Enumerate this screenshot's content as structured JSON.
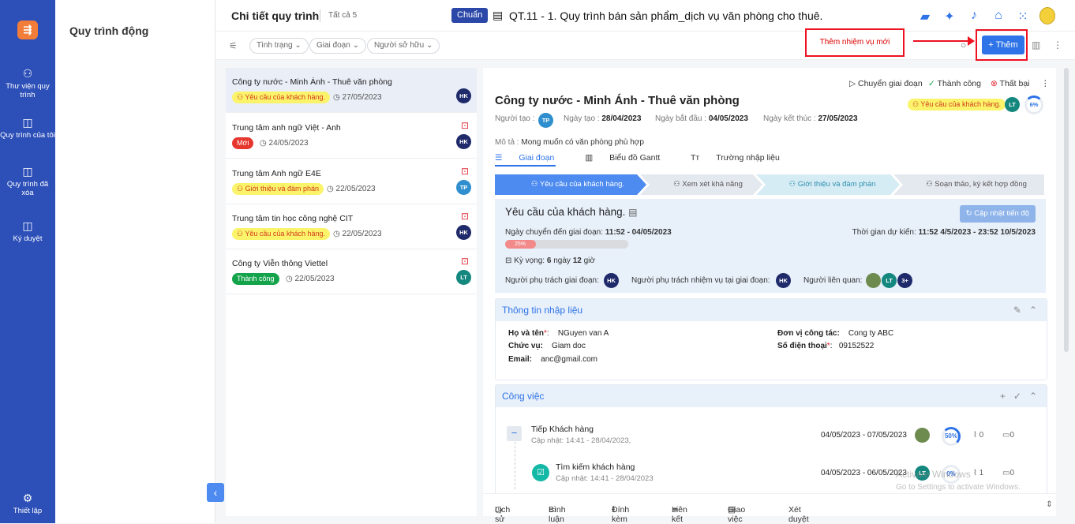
{
  "sidebar": {
    "logo": "⇶",
    "items": [
      {
        "label": "Thư viện quy trình",
        "icon": "process-library-icon"
      },
      {
        "label": "Quy trình của tôi",
        "icon": "my-process-icon"
      },
      {
        "label": "Quy trình đã xóa",
        "icon": "deleted-process-icon"
      },
      {
        "label": "Ký duyệt",
        "icon": "approval-icon"
      }
    ],
    "settings_label": "Thiết lập"
  },
  "subnav": {
    "title": "Quy trình động"
  },
  "header": {
    "page_title": "Chi tiết quy trình",
    "count": "Tất cả 5",
    "badge": "Chuẩn",
    "process_title": "QT.11 - 1. Quy trình bán sản phẩm_dịch vụ văn phòng cho thuê."
  },
  "filters": {
    "status": "Tình trạng",
    "stage": "Giai đoạn",
    "owner": "Người sở hữu"
  },
  "callout": "Thêm nhiệm vụ mới",
  "add_button": "+ Thêm",
  "list": [
    {
      "name": "Công ty nước - Minh Ánh - Thuê văn phòng",
      "tag": "Yêu cầu của khách hàng.",
      "date": "27/05/2023",
      "avatar": "HK"
    },
    {
      "name": "Trung tâm anh ngữ Việt - Anh",
      "tag": "Mới",
      "date": "24/05/2023",
      "avatar": "HK"
    },
    {
      "name": "Trung tâm Anh ngữ E4E",
      "tag": "Giới thiệu và đàm phán",
      "date": "22/05/2023",
      "avatar": "TP"
    },
    {
      "name": "Trung tâm tin học công nghệ CIT",
      "tag": "Yêu cầu của khách hàng.",
      "date": "22/05/2023",
      "avatar": "HK"
    },
    {
      "name": "Công ty Viễn thông Viettel",
      "tag": "Thành công",
      "date": "22/05/2023",
      "avatar": "LT"
    }
  ],
  "detail": {
    "actions": {
      "move": "Chuyển giai đoạn",
      "success": "Thành công",
      "fail": "Thất bại"
    },
    "title": "Công ty nước - Minh Ánh - Thuê văn phòng",
    "tag": "Yêu cầu của khách hàng.",
    "owner_avatar": "LT",
    "percent": "6%",
    "creator_label": "Người tạo :",
    "creator_avatar": "TP",
    "created_label": "Ngày tạo :",
    "created": "28/04/2023",
    "start_label": "Ngày bắt đầu :",
    "start": "04/05/2023",
    "end_label": "Ngày kết thúc :",
    "end": "27/05/2023",
    "desc_label": "Mô tả :",
    "desc": "Mong muốn có văn phòng phù hợp",
    "tabs": [
      "Giai đoạn",
      "Biểu đồ Gantt",
      "Trường nhập liệu"
    ],
    "stages": [
      "Yêu cầu của khách hàng.",
      "Xem xét khả năng",
      "Giới thiệu và đàm phán",
      "Soạn thảo, ký kết hợp đồng"
    ],
    "stage_box": {
      "title": "Yêu cầu của khách hàng.",
      "update_button": "Cập nhật tiến độ",
      "moved_label": "Ngày chuyển đến giai đoạn:",
      "moved": "11:52 - 04/05/2023",
      "expected_label": "Thời gian dự kiến:",
      "expected": "11:52 4/5/2023 - 23:52 10/5/2023",
      "progress_text": "25%",
      "progress": 0.25,
      "expect_label": "Kỳ vọng:",
      "expect_days": "6",
      "expect_days_unit": "ngày",
      "expect_hours": "12",
      "expect_hours_unit": "giờ",
      "stage_owner_label": "Người phụ trách giai đoạn:",
      "stage_owner": "HK",
      "task_owner_label": "Người phụ trách nhiệm vụ tại giai đoạn:",
      "task_owner": "HK",
      "related_label": "Người liên quan:",
      "related": [
        "LT",
        "3+"
      ]
    },
    "input_info": {
      "title": "Thông tin nhập liệu",
      "name_label": "Họ và tên",
      "name": "NGuyen van A",
      "unit_label": "Đơn vị công tác:",
      "unit": "Cong ty ABC",
      "position_label": "Chức vụ:",
      "position": "Giam doc",
      "phone_label": "Số điện thoại",
      "phone": "09152522",
      "email_label": "Email:",
      "email": "anc@gmail.com"
    },
    "work": {
      "title": "Công việc",
      "tasks": [
        {
          "name": "Tiếp Khách hàng",
          "updated": "Cập nhật: 14:41 - 28/04/2023,",
          "range": "04/05/2023 - 07/05/2023",
          "percent": "50%",
          "attachments": "0",
          "comments": "0"
        },
        {
          "name": "Tìm kiếm khách hàng",
          "updated": "Cập nhật: 14:41 - 28/04/2023",
          "range": "04/05/2023 - 06/05/2023",
          "avatar": "LT",
          "percent": "0%",
          "attachments": "1",
          "comments": "0"
        }
      ]
    },
    "bottom": [
      "Lịch sử",
      "Bình luận",
      "Đính kèm",
      "Liên kết",
      "Giao việc",
      "Xét duyệt"
    ]
  },
  "watermark": {
    "line1": "Activate Windows",
    "line2": "Go to Settings to activate Windows."
  },
  "colors": {
    "primary": "#2e73e8",
    "rail": "#2c4fb8",
    "navy_avatar": "#1f2a6b",
    "teal_avatar": "#14877f",
    "stage_active": "#4d8bf0"
  }
}
